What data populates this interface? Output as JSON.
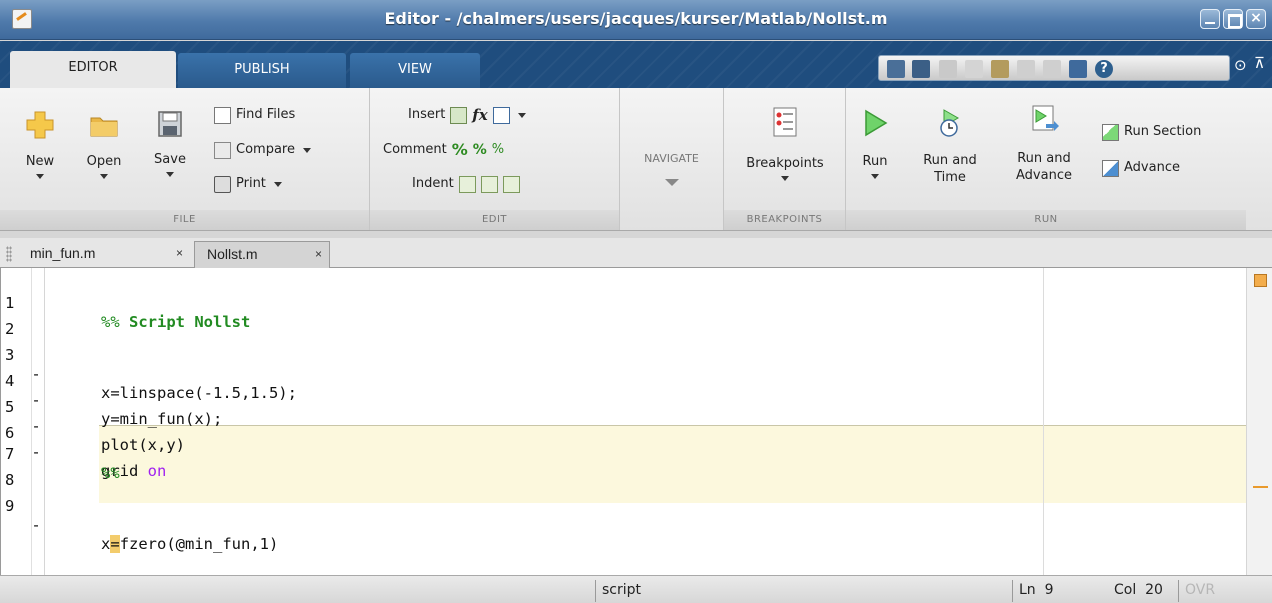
{
  "window": {
    "title": "Editor - /chalmers/users/jacques/kurser/Matlab/Nollst.m"
  },
  "ribbon_tabs": [
    {
      "label": "EDITOR",
      "active": true
    },
    {
      "label": "PUBLISH",
      "active": false
    },
    {
      "label": "VIEW",
      "active": false
    }
  ],
  "file_section": {
    "label": "FILE",
    "new_label": "New",
    "open_label": "Open",
    "save_label": "Save",
    "find_files_label": "Find Files",
    "compare_label": "Compare",
    "print_label": "Print"
  },
  "edit_section": {
    "label": "EDIT",
    "insert_label": "Insert",
    "comment_label": "Comment",
    "indent_label": "Indent",
    "fx_label": "fx"
  },
  "navigate_section": {
    "label": "NAVIGATE"
  },
  "breakpoints_section": {
    "label": "BREAKPOINTS",
    "button_label": "Breakpoints"
  },
  "run_section": {
    "label": "RUN",
    "run_label": "Run",
    "run_and_time_label_1": "Run and",
    "run_and_time_label_2": "Time",
    "run_and_advance_label_1": "Run and",
    "run_and_advance_label_2": "Advance",
    "run_section_label": "Run Section",
    "advance_label": "Advance"
  },
  "doc_tabs": [
    {
      "label": "min_fun.m",
      "active": false,
      "close": "×"
    },
    {
      "label": "Nollst.m",
      "active": true,
      "close": "×"
    }
  ],
  "editor": {
    "lines": [
      {
        "n": "1",
        "dash": ""
      },
      {
        "n": "2",
        "dash": ""
      },
      {
        "n": "3",
        "dash": "-",
        "code": "x=linspace(-1.5,1.5);"
      },
      {
        "n": "4",
        "dash": "-",
        "code": "y=min_fun(x);"
      },
      {
        "n": "5",
        "dash": "-",
        "code": "plot(x,y)"
      },
      {
        "n": "6",
        "dash": "-",
        "code_a": "grid ",
        "code_kw": "on"
      },
      {
        "n": "7",
        "dash": "",
        "code_cmt": "%%"
      },
      {
        "n": "8",
        "dash": ""
      },
      {
        "n": "9",
        "dash": "-",
        "code_a": "x",
        "code_hl": "=",
        "code_b": "fzero(@min_fun,1)"
      }
    ],
    "line1_prefix": "%% ",
    "line1_bold": "Script Nollst"
  },
  "status": {
    "mode": "script",
    "ln_label": "Ln",
    "ln_value": "9",
    "col_label": "Col",
    "col_value": "20",
    "ovr": "OVR"
  },
  "colors": {
    "title_bar": "#4f7aab",
    "tab_strip": "#1f4d7e",
    "comment_green": "#228b22",
    "keyword_purple": "#a020f0",
    "cell_band": "#fcf8dd",
    "warning_orange": "#f3ad4c"
  }
}
